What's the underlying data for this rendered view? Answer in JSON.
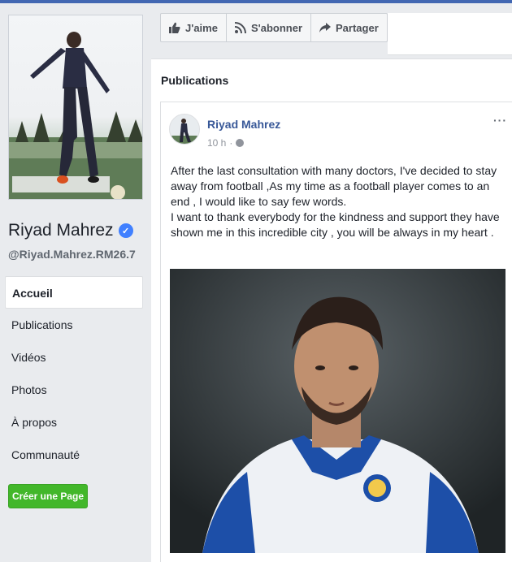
{
  "profile": {
    "name": "Riyad Mahrez",
    "handle": "@Riyad.Mahrez.RM26.7",
    "verified_mark": "✓"
  },
  "nav": {
    "items": [
      {
        "label": "Accueil",
        "active": true
      },
      {
        "label": "Publications",
        "active": false
      },
      {
        "label": "Vidéos",
        "active": false
      },
      {
        "label": "Photos",
        "active": false
      },
      {
        "label": "À propos",
        "active": false
      },
      {
        "label": "Communauté",
        "active": false
      }
    ],
    "create_page": "Créer une Page"
  },
  "actions": {
    "like": "J'aime",
    "subscribe": "S'abonner",
    "share": "Partager",
    "more": "···"
  },
  "publications": {
    "title": "Publications"
  },
  "post": {
    "author": "Riyad Mahrez",
    "time": "10 h",
    "separator": "·",
    "more": "···",
    "paragraphs": [
      "After the last consultation with many doctors, I've decided to stay away from football ,As my time as a football player comes to an end , I would like to say few words.",
      "I want to thank everybody for the kindness and support they have shown me in this incredible city , you will be always in my heart ."
    ]
  },
  "colors": {
    "link": "#385898",
    "create_button": "#42b72a",
    "verified": "#4080ff"
  },
  "icons": {
    "like": "thumbs-up-icon",
    "subscribe": "rss-icon",
    "share": "share-arrow-icon",
    "privacy": "globe-icon"
  }
}
